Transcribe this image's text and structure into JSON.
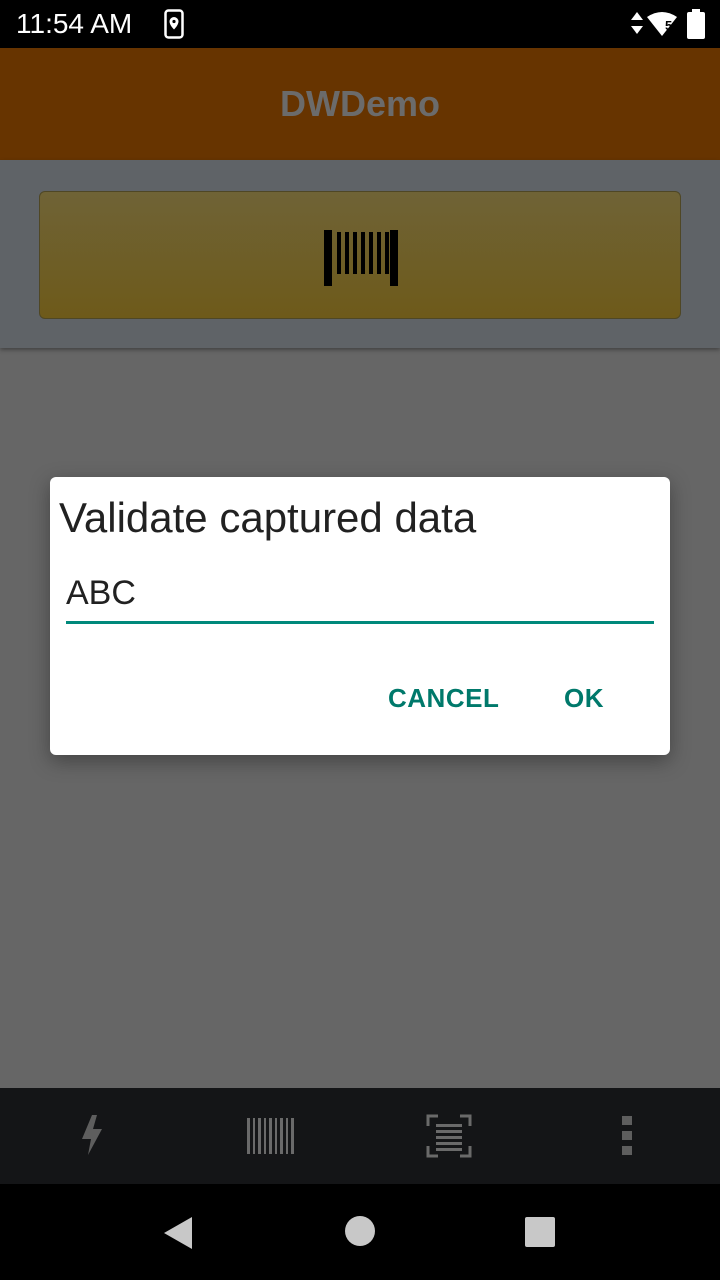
{
  "status_bar": {
    "time": "11:54 AM",
    "icons": [
      "location-phone-icon",
      "data-arrows-icon",
      "wifi-icon",
      "battery-icon"
    ],
    "wifi_badge": "5"
  },
  "app_bar": {
    "title": "DWDemo"
  },
  "scan_button": {
    "icon": "barcode-icon"
  },
  "dialog": {
    "title": "Validate captured data",
    "input_value": "ABC",
    "cancel_label": "CANCEL",
    "ok_label": "OK"
  },
  "bottom_toolbar": {
    "items": [
      "flash-icon",
      "barcode-icon",
      "scan-frame-icon",
      "more-vert-icon"
    ]
  },
  "nav_bar": {
    "buttons": [
      "back-icon",
      "home-icon",
      "recents-icon"
    ]
  },
  "colors": {
    "app_bar": "#673400",
    "accent": "#00796b",
    "input_underline": "#00897b",
    "scrim": "#666666"
  }
}
